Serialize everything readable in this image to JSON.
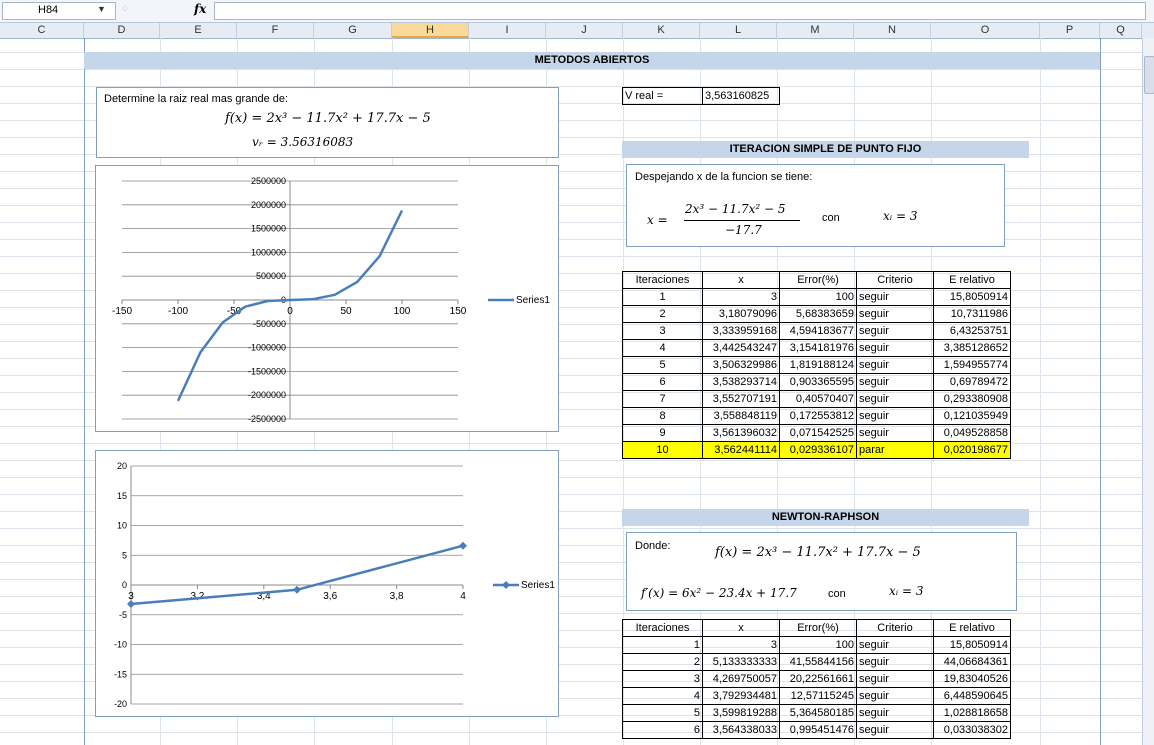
{
  "formula_bar": {
    "name_box": "H84",
    "fx_label": "fx",
    "formula": ""
  },
  "columns": [
    "C",
    "D",
    "E",
    "F",
    "G",
    "H",
    "I",
    "J",
    "K",
    "L",
    "M",
    "N",
    "O",
    "P",
    "Q"
  ],
  "selected_column": "H",
  "title": "METODOS ABIERTOS",
  "problem": {
    "prompt": "Determine la raiz real mas grande de:",
    "equation": "f(x) = 2x³ − 11.7x² + 17.7x − 5",
    "vr": "vᵣ = 3.56316083"
  },
  "vreal": {
    "label": "V real =",
    "value": "3,563160825"
  },
  "fixed_point": {
    "header": "ITERACION SIMPLE DE PUNTO FIJO",
    "note": "Despejando x de la funcion se tiene:",
    "lhs": "x =",
    "numerator": "2x³ − 11.7x² − 5",
    "denominator": "−17.7",
    "con": "con",
    "xi": "xᵢ = 3",
    "table_headers": [
      "Iteraciones",
      "x",
      "Error(%)",
      "Criterio",
      "E relativo"
    ],
    "rows": [
      [
        "1",
        "3",
        "100",
        "seguir",
        "15,8050914"
      ],
      [
        "2",
        "3,18079096",
        "5,68383659",
        "seguir",
        "10,7311986"
      ],
      [
        "3",
        "3,333959168",
        "4,594183677",
        "seguir",
        "6,43253751"
      ],
      [
        "4",
        "3,442543247",
        "3,154181976",
        "seguir",
        "3,385128652"
      ],
      [
        "5",
        "3,506329986",
        "1,819188124",
        "seguir",
        "1,594955774"
      ],
      [
        "6",
        "3,538293714",
        "0,903365595",
        "seguir",
        "0,69789472"
      ],
      [
        "7",
        "3,552707191",
        "0,40570407",
        "seguir",
        "0,293380908"
      ],
      [
        "8",
        "3,558848119",
        "0,172553812",
        "seguir",
        "0,121035949"
      ],
      [
        "9",
        "3,561396032",
        "0,071542525",
        "seguir",
        "0,049528858"
      ],
      [
        "10",
        "3,562441114",
        "0,029336107",
        "parar",
        "0,020198677"
      ]
    ]
  },
  "newton": {
    "header": "NEWTON-RAPHSON",
    "donde": "Donde:",
    "f": "f(x) = 2x³ − 11.7x² + 17.7x − 5",
    "fprime": "f′(x) = 6x² − 23.4x + 17.7",
    "con": "con",
    "xi": "xᵢ = 3",
    "table_headers": [
      "Iteraciones",
      "x",
      "Error(%)",
      "Criterio",
      "E relativo"
    ],
    "rows": [
      [
        "1",
        "3",
        "100",
        "seguir",
        "15,8050914"
      ],
      [
        "2",
        "5,133333333",
        "41,55844156",
        "seguir",
        "44,06684361"
      ],
      [
        "3",
        "4,269750057",
        "20,22561661",
        "seguir",
        "19,83040526"
      ],
      [
        "4",
        "3,792934481",
        "12,57115245",
        "seguir",
        "6,448590645"
      ],
      [
        "5",
        "3,599819288",
        "5,364580185",
        "seguir",
        "1,028818658"
      ],
      [
        "6",
        "3,564338033",
        "0,995451476",
        "seguir",
        "0,033038302"
      ]
    ]
  },
  "chart_data": [
    {
      "type": "line",
      "series": [
        {
          "name": "Series1",
          "x": [
            -100,
            -80,
            -60,
            -40,
            -20,
            0,
            20,
            40,
            60,
            80,
            100
          ],
          "values": [
            -2120000,
            -1100000,
            -470000,
            -140000,
            -20000,
            0,
            14000,
            110000,
            380000,
            920000,
            1880000
          ]
        }
      ],
      "xlim": [
        -150,
        150
      ],
      "ylim": [
        -2500000,
        2500000
      ],
      "x_ticks": [
        "-150",
        "-100",
        "-50",
        "0",
        "50",
        "100",
        "150"
      ],
      "y_ticks": [
        "2500000",
        "2000000",
        "1500000",
        "1000000",
        "500000",
        "0",
        "-500000",
        "-1000000",
        "-1500000",
        "-2000000",
        "-2500000"
      ],
      "legend": "right"
    },
    {
      "type": "line",
      "series": [
        {
          "name": "Series1",
          "x": [
            3,
            3.5,
            4
          ],
          "values": [
            -3.2,
            -0.8,
            6.6
          ]
        }
      ],
      "xlim": [
        3,
        4
      ],
      "ylim": [
        -20,
        20
      ],
      "x_ticks": [
        "3",
        "3,2",
        "3,4",
        "3,6",
        "3,8",
        "4"
      ],
      "y_ticks": [
        "20",
        "15",
        "10",
        "5",
        "0",
        "-5",
        "-10",
        "-15",
        "-20"
      ],
      "legend": "right"
    }
  ]
}
